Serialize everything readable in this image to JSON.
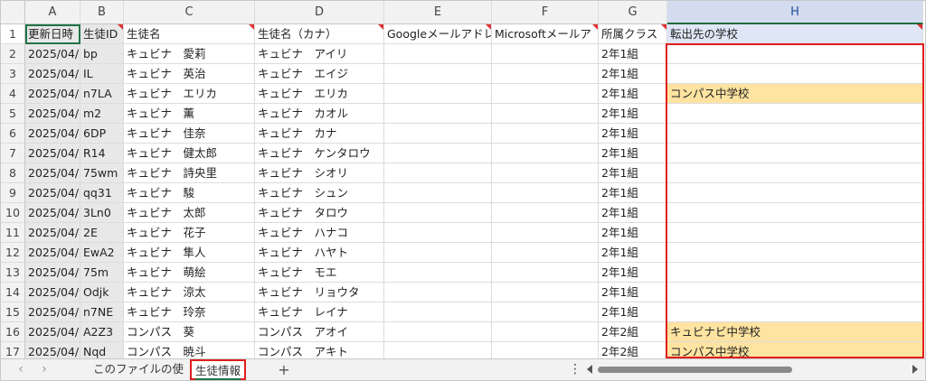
{
  "columns": [
    "A",
    "B",
    "C",
    "D",
    "E",
    "F",
    "G",
    "H"
  ],
  "selected_column": "H",
  "header_row": {
    "row_num": "1",
    "cells": [
      "更新日時",
      "生徒ID",
      "生徒名",
      "生徒名（カナ）",
      "Googleメールアドレ",
      "Microsoftメールア",
      "所属クラス",
      "転出先の学校"
    ]
  },
  "rows": [
    {
      "n": "2",
      "A": "2025/04/:",
      "B": "bp",
      "C": "キュビナ　愛莉",
      "D": "キュビナ　アイリ",
      "E": "",
      "F": "",
      "G": "2年1組",
      "H": ""
    },
    {
      "n": "3",
      "A": "2025/04/:",
      "B": "IL",
      "C": "キュビナ　英治",
      "D": "キュビナ　エイジ",
      "E": "",
      "F": "",
      "G": "2年1組",
      "H": ""
    },
    {
      "n": "4",
      "A": "2025/04/:",
      "B": "n7LA",
      "C": "キュビナ　エリカ",
      "D": "キュビナ　エリカ",
      "E": "",
      "F": "",
      "G": "2年1組",
      "H": "コンパス中学校"
    },
    {
      "n": "5",
      "A": "2025/04/:",
      "B": "m2",
      "C": "キュビナ　薫",
      "D": "キュビナ　カオル",
      "E": "",
      "F": "",
      "G": "2年1組",
      "H": ""
    },
    {
      "n": "6",
      "A": "2025/04/:",
      "B": "6DP",
      "C": "キュビナ　佳奈",
      "D": "キュビナ　カナ",
      "E": "",
      "F": "",
      "G": "2年1組",
      "H": ""
    },
    {
      "n": "7",
      "A": "2025/04/:",
      "B": "R14",
      "C": "キュビナ　健太郎",
      "D": "キュビナ　ケンタロウ",
      "E": "",
      "F": "",
      "G": "2年1組",
      "H": ""
    },
    {
      "n": "8",
      "A": "2025/04/:",
      "B": "75wm",
      "C": "キュビナ　詩央里",
      "D": "キュビナ　シオリ",
      "E": "",
      "F": "",
      "G": "2年1組",
      "H": ""
    },
    {
      "n": "9",
      "A": "2025/04/:",
      "B": "qq31",
      "C": "キュビナ　駿",
      "D": "キュビナ　シュン",
      "E": "",
      "F": "",
      "G": "2年1組",
      "H": ""
    },
    {
      "n": "10",
      "A": "2025/04/:",
      "B": "3Ln0",
      "C": "キュビナ　太郎",
      "D": "キュビナ　タロウ",
      "E": "",
      "F": "",
      "G": "2年1組",
      "H": ""
    },
    {
      "n": "11",
      "A": "2025/04/:",
      "B": "2E",
      "C": "キュビナ　花子",
      "D": "キュビナ　ハナコ",
      "E": "",
      "F": "",
      "G": "2年1組",
      "H": ""
    },
    {
      "n": "12",
      "A": "2025/04/(",
      "B": "EwA2",
      "C": "キュビナ　隼人",
      "D": "キュビナ　ハヤト",
      "E": "",
      "F": "",
      "G": "2年1組",
      "H": ""
    },
    {
      "n": "13",
      "A": "2025/04/(",
      "B": "75m",
      "C": "キュビナ　萌絵",
      "D": "キュビナ　モエ",
      "E": "",
      "F": "",
      "G": "2年1組",
      "H": ""
    },
    {
      "n": "14",
      "A": "2025/04/(",
      "B": "Odjk",
      "C": "キュビナ　涼太",
      "D": "キュビナ　リョウタ",
      "E": "",
      "F": "",
      "G": "2年1組",
      "H": ""
    },
    {
      "n": "15",
      "A": "2025/04/(",
      "B": "n7NE",
      "C": "キュビナ　玲奈",
      "D": "キュビナ　レイナ",
      "E": "",
      "F": "",
      "G": "2年1組",
      "H": ""
    },
    {
      "n": "16",
      "A": "2025/04/(",
      "B": "A2Z3",
      "C": "コンパス　葵",
      "D": "コンパス　アオイ",
      "E": "",
      "F": "",
      "G": "2年2組",
      "H": "キュビナビ中学校"
    },
    {
      "n": "17",
      "A": "2025/04/(",
      "B": "Nqd",
      "C": "コンパス　暁斗",
      "D": "コンパス　アキト",
      "E": "",
      "F": "",
      "G": "2年2組",
      "H": "コンパス中学校"
    }
  ],
  "highlight_color": "#ffe3a0",
  "sheet_tabs": [
    {
      "label": "このファイルの使い方",
      "active": false
    },
    {
      "label": "生徒情報",
      "active": true
    }
  ],
  "add_sheet_label": "+",
  "more_label": "⋮",
  "nav_prev": "‹",
  "nav_next": "›"
}
